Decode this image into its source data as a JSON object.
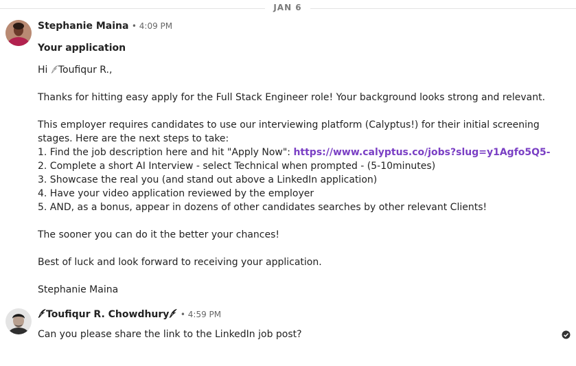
{
  "date_divider": {
    "label": "JAN 6"
  },
  "messages": [
    {
      "sender": "Stephanie Maina",
      "time": "4:09 PM",
      "subject": "Your application",
      "greeting_prefix": "Hi ",
      "greeting_name": "Toufiqur R.,",
      "body": {
        "p1": "Thanks for hitting easy apply for the Full Stack Engineer role! Your background looks strong and relevant.",
        "p2a": "This employer requires candidates to use our interviewing platform (Calyptus!) for their initial screening",
        "p2b": "stages. Here are the next steps to take:",
        "step1_prefix": "1. Find the job description here and hit \"Apply Now\": ",
        "step1_link": "https://www.calyptus.co/jobs?slug=y1Agfo5Q5-",
        "step2": "2. Complete a short AI Interview - select Technical when prompted - (5-10minutes)",
        "step3": "3. Showcase the real you (and stand out above a LinkedIn application)",
        "step4": "4. Have your video application reviewed by the employer",
        "step5": "5. AND, as a bonus, appear in dozens of other candidates searches by other relevant Clients!",
        "p3": "The sooner you can do it the better your chances!",
        "p4": "Best of luck and look forward to receiving your application.",
        "signature": "Stephanie Maina"
      }
    },
    {
      "sender": "Toufiqur R. Chowdhury",
      "time": "4:59 PM",
      "text": "Can you please share the link to the LinkedIn job post?",
      "status": "delivered-check-icon"
    }
  ],
  "separator": "•",
  "colors": {
    "link": "#7a3fc4",
    "divider": "#e3e3e3",
    "timestamp": "#666666"
  }
}
